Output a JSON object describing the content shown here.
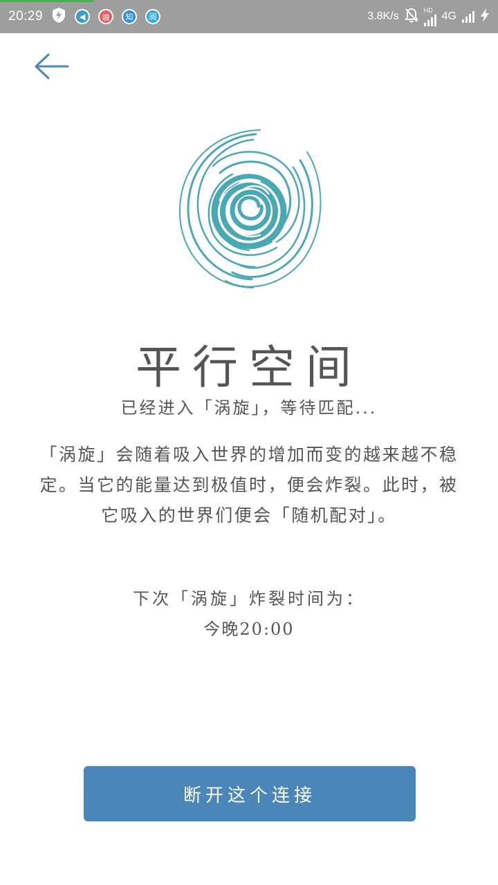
{
  "status_bar": {
    "time": "20:29",
    "network_speed": "3.8K/s",
    "network_type": "4G",
    "hd_label": "HD",
    "notification_icons": [
      "shield-bolt-icon",
      "app-icon-1",
      "app-icon-2",
      "app-icon-zhi",
      "app-icon-blue"
    ],
    "notif_glyphs": [
      "◀",
      "▤",
      "知",
      "阅"
    ]
  },
  "header": {
    "back_icon": "arrow-left-icon"
  },
  "main": {
    "title": "平行空间",
    "subtitle": "已经进入「涡旋」，等待匹配...",
    "description": "「涡旋」会随着吸入世界的增加而变的越来越不稳定。当它的能量达到极值时，便会炸裂。此时，被它吸入的世界们便会「随机配对」。",
    "next_burst_label": "下次「涡旋」炸裂时间为：",
    "next_burst_time": "今晚20:00"
  },
  "actions": {
    "disconnect_label": "断开这个连接"
  },
  "colors": {
    "accent": "#4a86b8",
    "vortex": "#4aa7b4",
    "text": "#555555",
    "status_bar": "#9e9e9e"
  }
}
